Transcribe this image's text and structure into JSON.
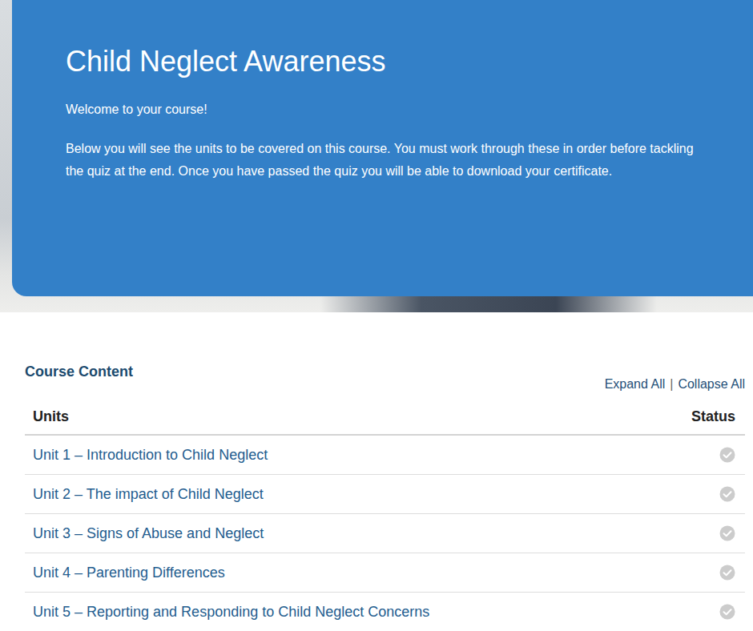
{
  "course": {
    "title": "Child Neglect Awareness",
    "welcome": "Welcome to your course!",
    "description": "Below you will see the units to be covered on this course. You must work through these in order before tackling the quiz at the end. Once you have passed the quiz you will be able to download your certificate."
  },
  "content": {
    "heading": "Course Content",
    "expand_all": "Expand All",
    "separator": "|",
    "collapse_all": "Collapse All"
  },
  "table": {
    "columns": [
      "Units",
      "Status"
    ],
    "rows": [
      {
        "title": "Unit 1 – Introduction to Child Neglect",
        "completed": false,
        "color": "#cccccc"
      },
      {
        "title": "Unit 2 – The impact of Child Neglect",
        "completed": false,
        "color": "#cccccc"
      },
      {
        "title": "Unit 3 – Signs of Abuse and Neglect",
        "completed": false,
        "color": "#cccccc"
      },
      {
        "title": "Unit 4 – Parenting Differences",
        "completed": false,
        "color": "#cccccc"
      },
      {
        "title": "Unit 5 – Reporting and Responding to Child Neglect Concerns",
        "completed": false,
        "color": "#cccccc"
      }
    ]
  }
}
